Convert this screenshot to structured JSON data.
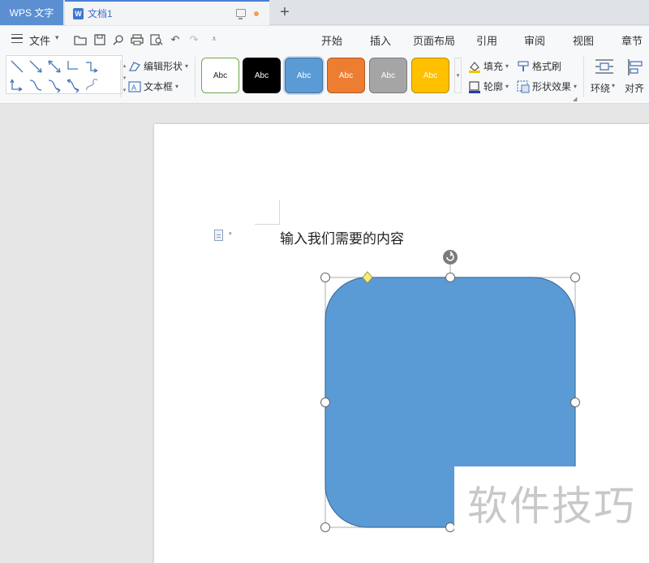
{
  "titlebar": {
    "app_tab": "WPS 文字",
    "doc_tab": "文档1",
    "new_tab_icon": "+"
  },
  "menubar": {
    "file": "文件",
    "tabs": [
      "开始",
      "插入",
      "页面布局",
      "引用",
      "审阅",
      "视图",
      "章节"
    ]
  },
  "ribbon": {
    "edit_shape": "编辑形状",
    "text_box": "文本框",
    "style_presets": [
      {
        "label": "Abc",
        "bg": "#ffffff",
        "fg": "#222222",
        "border": "#6aa84f"
      },
      {
        "label": "Abc",
        "bg": "#000000",
        "fg": "#ffffff",
        "border": "#000000"
      },
      {
        "label": "Abc",
        "bg": "#5b9bd5",
        "fg": "#ffffff",
        "border": "#41719c"
      },
      {
        "label": "Abc",
        "bg": "#ed7d31",
        "fg": "#ffffff",
        "border": "#ae5a21"
      },
      {
        "label": "Abc",
        "bg": "#a5a5a5",
        "fg": "#ffffff",
        "border": "#7b7b7b"
      },
      {
        "label": "Abc",
        "bg": "#ffc000",
        "fg": "#ffffff",
        "border": "#bc8c00"
      }
    ],
    "fill": "填充",
    "outline": "轮廓",
    "format_painter": "格式刷",
    "shape_effects": "形状效果",
    "wrap": "环绕",
    "align": "对齐"
  },
  "document": {
    "text": "输入我们需要的内容"
  },
  "shape": {
    "fill": "#5b9bd5",
    "stroke": "#41719c"
  },
  "watermark": "软件技巧"
}
